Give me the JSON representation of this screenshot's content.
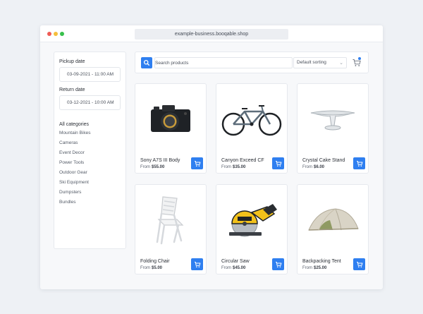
{
  "browser": {
    "url": "example-business.booqable.shop"
  },
  "sidebar": {
    "pickup_label": "Pickup date",
    "pickup_value": "03-09-2021 - 11:00 AM",
    "return_label": "Return date",
    "return_value": "03-12-2021 - 10:00 AM",
    "categories_title": "All categories",
    "categories": [
      "Mountain Bikes",
      "Cameras",
      "Event Decor",
      "Power Tools",
      "Outdoor Gear",
      "Ski Equipment",
      "Dumpsters",
      "Bundles"
    ]
  },
  "toolbar": {
    "search_placeholder": "Search products",
    "sort_value": "Default sorting",
    "icons": {
      "search": "search-icon",
      "cart": "cart-icon",
      "sort": "chevron-down-icon"
    }
  },
  "products": [
    {
      "name": "Sony A7S III Body",
      "price_prefix": "From",
      "price": "$55.00",
      "icon": "camera"
    },
    {
      "name": "Canyon Exceed CF",
      "price_prefix": "From",
      "price": "$35.00",
      "icon": "bicycle"
    },
    {
      "name": "Crystal Cake Stand",
      "price_prefix": "From",
      "price": "$6.00",
      "icon": "cake-stand"
    },
    {
      "name": "Folding Chair",
      "price_prefix": "From",
      "price": "$5.00",
      "icon": "chair"
    },
    {
      "name": "Circular Saw",
      "price_prefix": "From",
      "price": "$45.00",
      "icon": "saw"
    },
    {
      "name": "Backpacking Tent",
      "price_prefix": "From",
      "price": "$25.00",
      "icon": "tent"
    }
  ],
  "colors": {
    "accent": "#2f7ff0",
    "background": "#eef1f5"
  }
}
